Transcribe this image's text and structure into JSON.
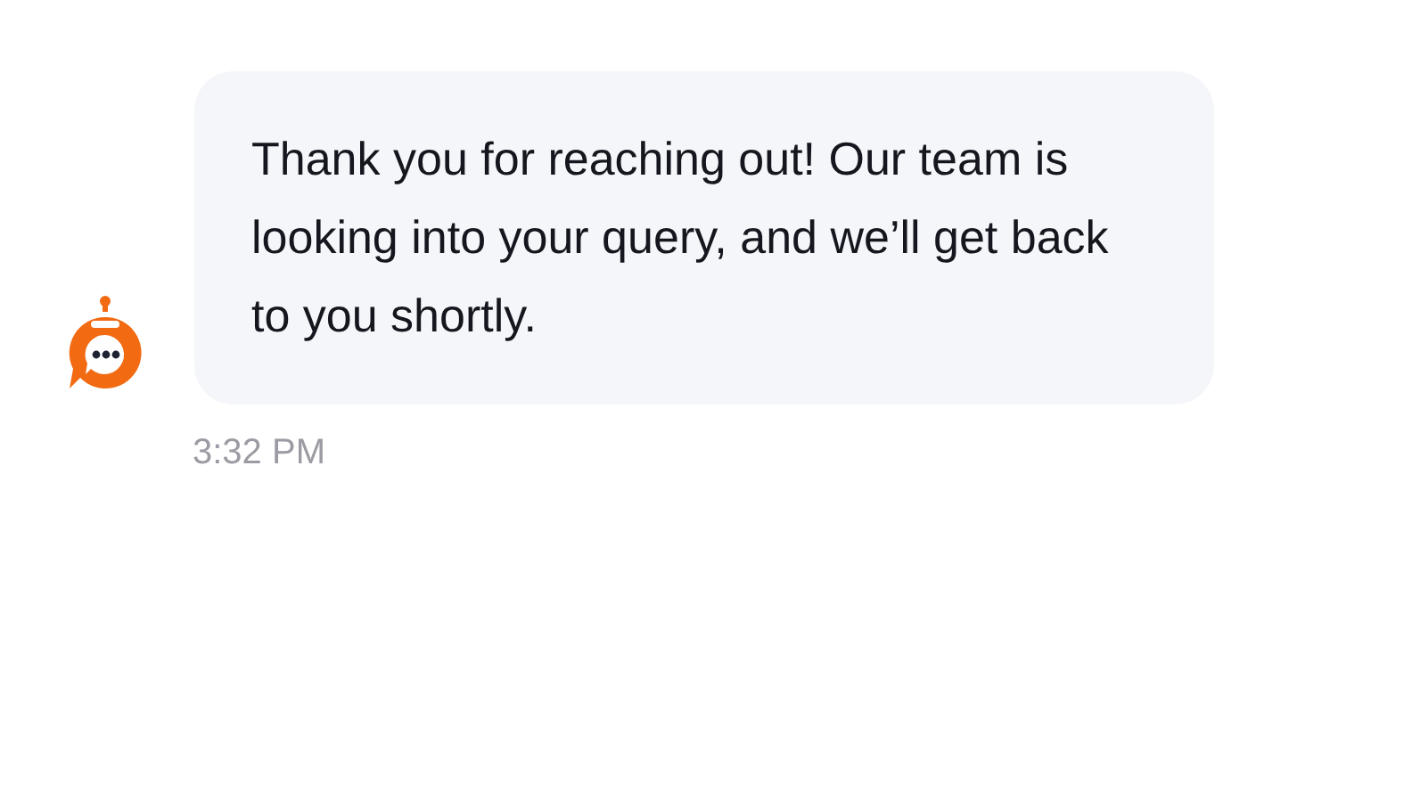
{
  "message": {
    "text": "Thank you for reaching out! Our team is looking into your query, and we’ll get back to you shortly.",
    "time": "3:32 PM"
  }
}
